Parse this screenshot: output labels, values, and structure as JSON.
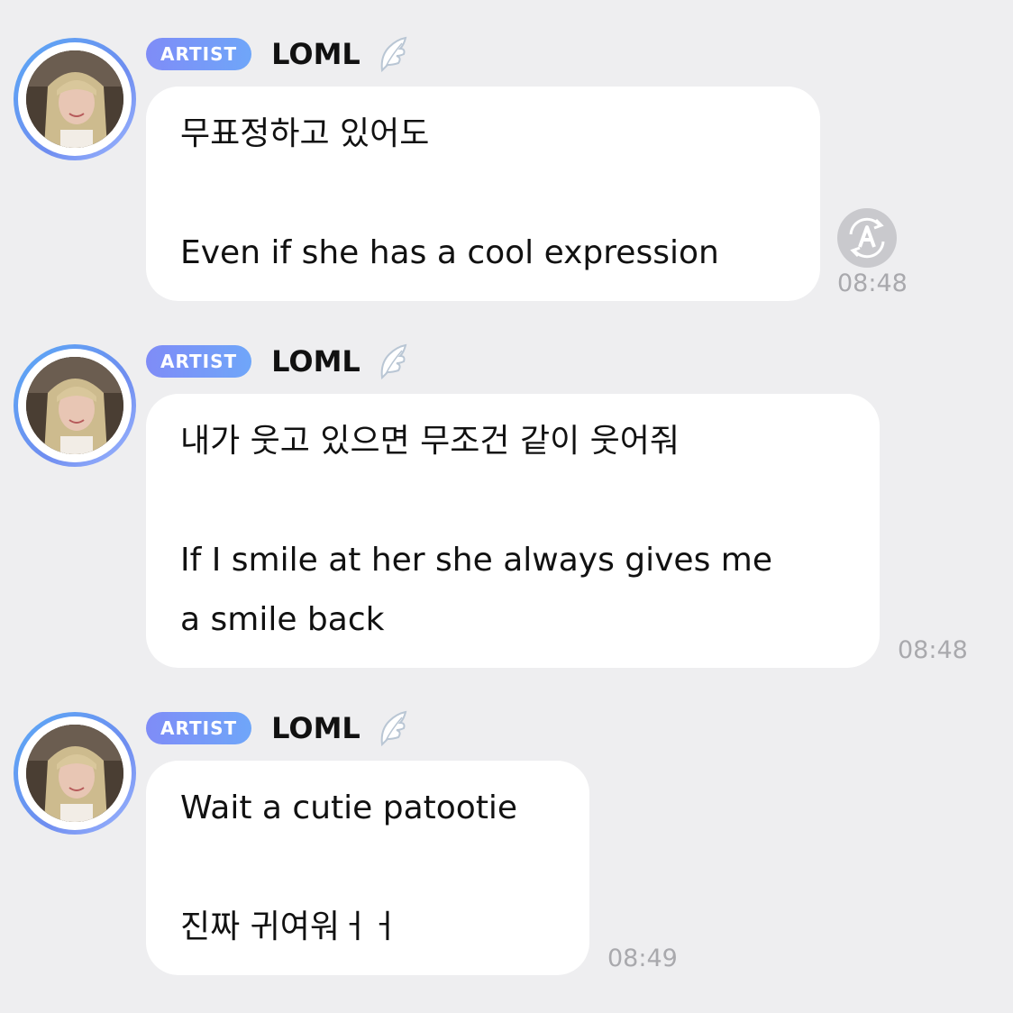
{
  "messages": [
    {
      "badge": "ARTIST",
      "sender": "LOML",
      "lines": [
        "무표정하고 있어도",
        "",
        "Even if she has a cool expression"
      ],
      "time": "08:48",
      "has_translate_icon": true
    },
    {
      "badge": "ARTIST",
      "sender": "LOML",
      "lines": [
        "내가 웃고 있으면 무조건 같이 웃어줘",
        "",
        "If I smile at her she always gives me",
        "a smile back"
      ],
      "time": "08:48",
      "has_translate_icon": false
    },
    {
      "badge": "ARTIST",
      "sender": "LOML",
      "lines": [
        "Wait a cutie patootie",
        "",
        "진짜 귀여워ㅓㅓ"
      ],
      "time": "08:49",
      "has_translate_icon": false
    }
  ],
  "icons": {
    "wing": "wing-icon",
    "translate": "translate-icon",
    "avatar": "avatar"
  },
  "colors": {
    "background": "#eeeef0",
    "bubble": "#ffffff",
    "badge_start": "#7f8cf7",
    "badge_end": "#6fa6f9",
    "timestamp": "#a9a9ad"
  }
}
